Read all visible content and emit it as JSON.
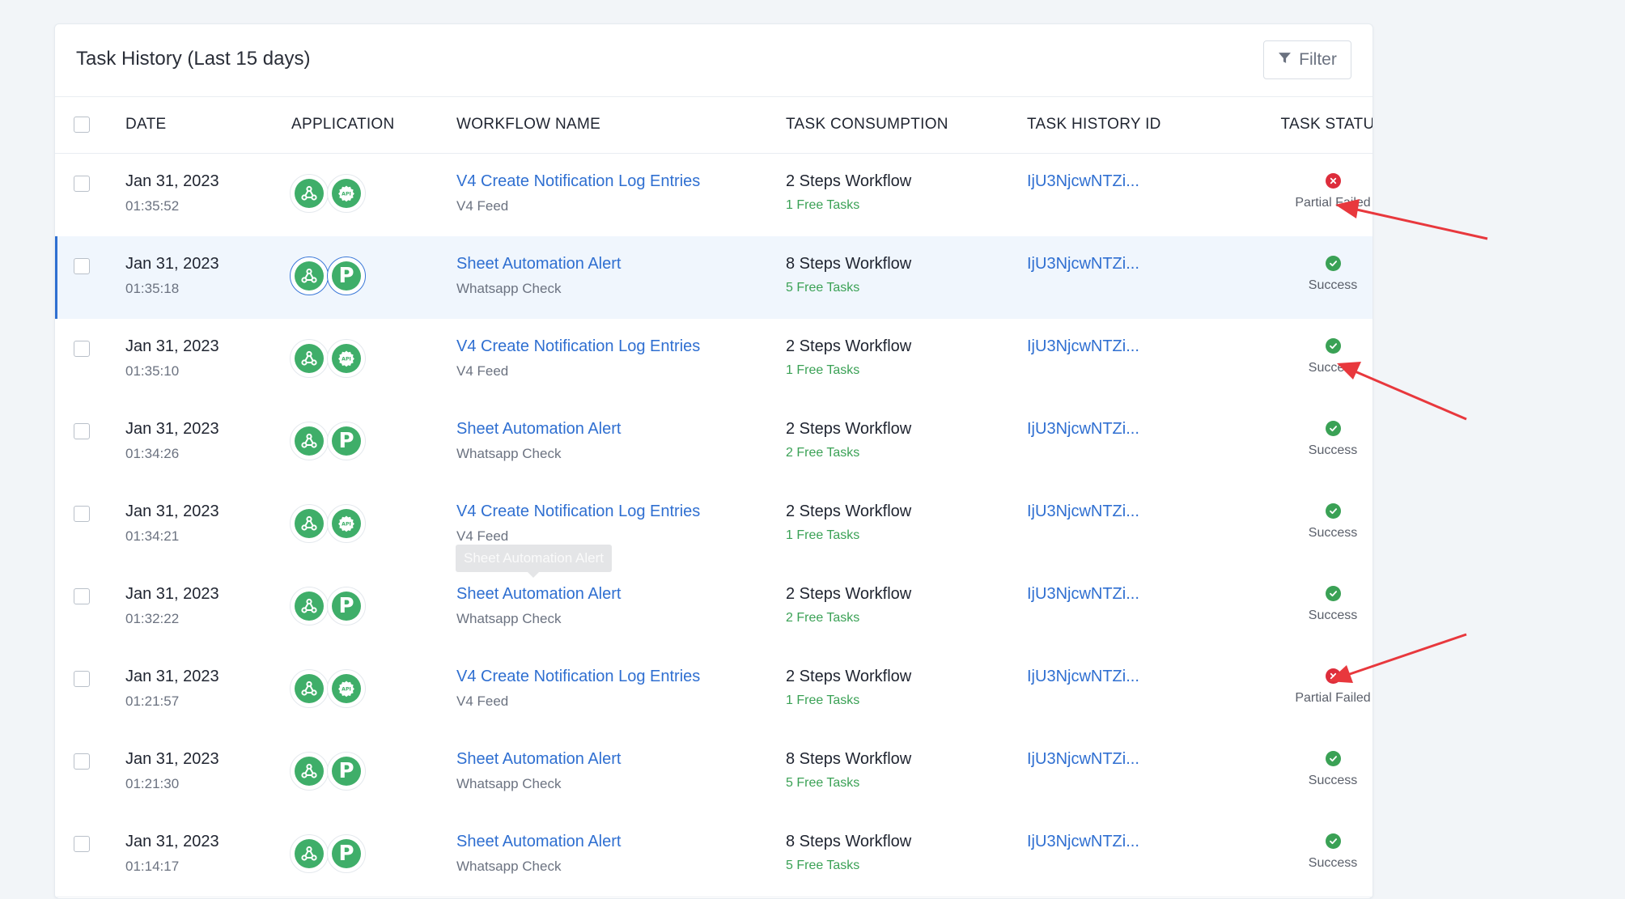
{
  "header": {
    "title": "Task History (Last 15 days)",
    "filter_label": "Filter",
    "filter_icon": "funnel-icon"
  },
  "columns": {
    "date": "DATE",
    "application": "APPLICATION",
    "workflow_name": "WORKFLOW NAME",
    "task_consumption": "TASK CONSUMPTION",
    "task_history_id": "TASK HISTORY ID",
    "task_status": "TASK STATUS"
  },
  "rows": [
    {
      "date": "Jan 31, 2023",
      "time": "01:35:52",
      "apps": [
        "webhook-icon",
        "api-icon"
      ],
      "workflow": "V4 Create Notification Log Entries",
      "sub": "V4 Feed",
      "steps": "2 Steps Workflow",
      "free": "1 Free Tasks",
      "id": "IjU3NjcwNTZi...",
      "status": "Partial Failed",
      "status_kind": "fail"
    },
    {
      "date": "Jan 31, 2023",
      "time": "01:35:18",
      "apps": [
        "webhook-icon",
        "pabbly-icon"
      ],
      "workflow": "Sheet Automation Alert",
      "sub": "Whatsapp Check",
      "steps": "8 Steps Workflow",
      "free": "5 Free Tasks",
      "id": "IjU3NjcwNTZi...",
      "status": "Success",
      "status_kind": "ok",
      "selected": true
    },
    {
      "date": "Jan 31, 2023",
      "time": "01:35:10",
      "apps": [
        "webhook-icon",
        "api-icon"
      ],
      "workflow": "V4 Create Notification Log Entries",
      "sub": "V4 Feed",
      "steps": "2 Steps Workflow",
      "free": "1 Free Tasks",
      "id": "IjU3NjcwNTZi...",
      "status": "Success",
      "status_kind": "ok"
    },
    {
      "date": "Jan 31, 2023",
      "time": "01:34:26",
      "apps": [
        "webhook-icon",
        "pabbly-icon"
      ],
      "workflow": "Sheet Automation Alert",
      "sub": "Whatsapp Check",
      "steps": "2 Steps Workflow",
      "free": "2 Free Tasks",
      "id": "IjU3NjcwNTZi...",
      "status": "Success",
      "status_kind": "ok"
    },
    {
      "date": "Jan 31, 2023",
      "time": "01:34:21",
      "apps": [
        "webhook-icon",
        "api-icon"
      ],
      "workflow": "V4 Create Notification Log Entries",
      "sub": "V4 Feed",
      "steps": "2 Steps Workflow",
      "free": "1 Free Tasks",
      "id": "IjU3NjcwNTZi...",
      "status": "Success",
      "status_kind": "ok"
    },
    {
      "date": "Jan 31, 2023",
      "time": "01:32:22",
      "apps": [
        "webhook-icon",
        "pabbly-icon"
      ],
      "workflow": "Sheet Automation Alert",
      "sub": "Whatsapp Check",
      "steps": "2 Steps Workflow",
      "free": "2 Free Tasks",
      "id": "IjU3NjcwNTZi...",
      "status": "Success",
      "status_kind": "ok"
    },
    {
      "date": "Jan 31, 2023",
      "time": "01:21:57",
      "apps": [
        "webhook-icon",
        "api-icon"
      ],
      "workflow": "V4 Create Notification Log Entries",
      "sub": "V4 Feed",
      "steps": "2 Steps Workflow",
      "free": "1 Free Tasks",
      "id": "IjU3NjcwNTZi...",
      "status": "Partial Failed",
      "status_kind": "fail"
    },
    {
      "date": "Jan 31, 2023",
      "time": "01:21:30",
      "apps": [
        "webhook-icon",
        "pabbly-icon"
      ],
      "workflow": "Sheet Automation Alert",
      "sub": "Whatsapp Check",
      "steps": "8 Steps Workflow",
      "free": "5 Free Tasks",
      "id": "IjU3NjcwNTZi...",
      "status": "Success",
      "status_kind": "ok"
    },
    {
      "date": "Jan 31, 2023",
      "time": "01:14:17",
      "apps": [
        "webhook-icon",
        "pabbly-icon"
      ],
      "workflow": "Sheet Automation Alert",
      "sub": "Whatsapp Check",
      "steps": "8 Steps Workflow",
      "free": "5 Free Tasks",
      "id": "IjU3NjcwNTZi...",
      "status": "Success",
      "status_kind": "ok"
    }
  ],
  "tooltip": "Sheet Automation Alert",
  "colors": {
    "link": "#2f6fd1",
    "success": "#3aa155",
    "fail": "#dd2d3b",
    "app_green": "#3fae69",
    "annotation_arrow": "#e8383d"
  }
}
